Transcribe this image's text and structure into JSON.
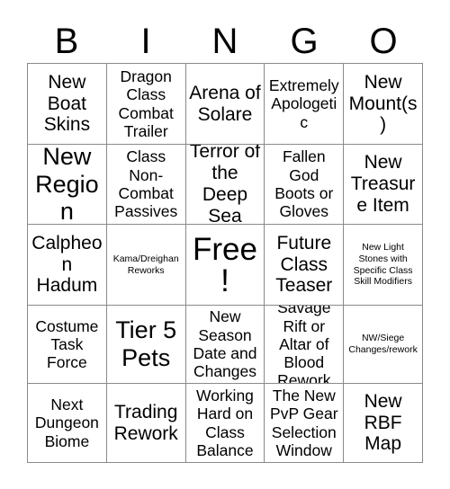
{
  "card": {
    "header_letters": [
      "B",
      "I",
      "N",
      "G",
      "O"
    ],
    "rows": [
      [
        {
          "text": "New Boat Skins",
          "size": "lg"
        },
        {
          "text": "Dragon Class Combat Trailer",
          "size": "md"
        },
        {
          "text": "Arena of Solare",
          "size": "lg"
        },
        {
          "text": "Extremely Apologetic",
          "size": "md"
        },
        {
          "text": "New Mount(s)",
          "size": "lg"
        }
      ],
      [
        {
          "text": "New Region",
          "size": "xl"
        },
        {
          "text": "Class Non-Combat Passives",
          "size": "md"
        },
        {
          "text": "Terror of the Deep Sea",
          "size": "lg"
        },
        {
          "text": "Fallen God Boots or Gloves",
          "size": "md"
        },
        {
          "text": "New Treasure Item",
          "size": "lg"
        }
      ],
      [
        {
          "text": "Calpheon Hadum",
          "size": "lg"
        },
        {
          "text": "Kama/Dreighan Reworks",
          "size": "xs"
        },
        {
          "text": "Free!",
          "size": "free"
        },
        {
          "text": "Future Class Teaser",
          "size": "lg"
        },
        {
          "text": "New Light Stones with Specific Class Skill Modifiers",
          "size": "xs"
        }
      ],
      [
        {
          "text": "Costume Task Force",
          "size": "md"
        },
        {
          "text": "Tier 5 Pets",
          "size": "xl"
        },
        {
          "text": "New Season Date and Changes",
          "size": "md"
        },
        {
          "text": "Savage Rift or Altar of Blood Rework",
          "size": "md"
        },
        {
          "text": "NW/Siege Changes/rework",
          "size": "xs"
        }
      ],
      [
        {
          "text": "Next Dungeon Biome",
          "size": "md"
        },
        {
          "text": "Trading Rework",
          "size": "lg"
        },
        {
          "text": "Working Hard on Class Balance",
          "size": "md"
        },
        {
          "text": "The New PvP Gear Selection Window",
          "size": "md"
        },
        {
          "text": "New RBF Map",
          "size": "lg"
        }
      ]
    ]
  },
  "colors": {
    "background": "#ffffff",
    "grid_line": "#8a8a8a",
    "text": "#000000"
  }
}
